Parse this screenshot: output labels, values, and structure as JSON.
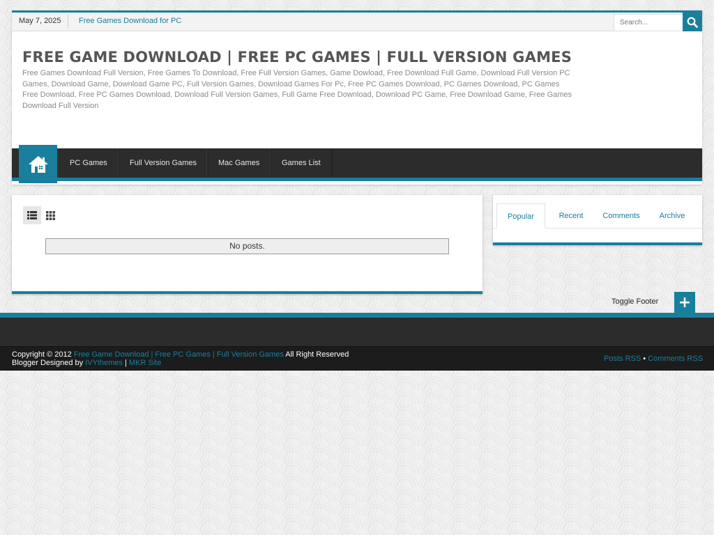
{
  "topbar": {
    "date": "May 7, 2025",
    "ticker_link": "Free Games Download for PC",
    "search_placeholder": "Search..."
  },
  "header": {
    "title": "FREE GAME DOWNLOAD | FREE PC GAMES | FULL VERSION GAMES",
    "description": "Free Games Download Full Version, Free Games To Download, Free Full Version Games, Game Dowload, Free Download Full Game, Download Full Version PC Games, Download Game, Download Game PC, Full Version Games, Download Games For Pc, Free PC Games Download, PC Games Download, PC Games Free Download, Free PC Games Download, Download Full Version Games, Full Game Free Download, Download PC Game, Free Download Game, Free Games Download Full Version"
  },
  "nav": {
    "home_icon": "home-icon",
    "items": [
      {
        "label": "PC Games"
      },
      {
        "label": "Full Version Games"
      },
      {
        "label": "Mac Games"
      },
      {
        "label": "Games List"
      }
    ]
  },
  "main": {
    "view_icons": [
      "list-view-icon",
      "grid-view-icon"
    ],
    "empty_message": "No posts."
  },
  "sidebar": {
    "tabs": [
      {
        "label": "Popular",
        "active": true
      },
      {
        "label": "Recent"
      },
      {
        "label": "Comments"
      },
      {
        "label": "Archive"
      }
    ]
  },
  "toggle_footer": {
    "label": "Toggle Footer",
    "button": "+"
  },
  "footer": {
    "copyright_prefix": "Copyright © 2012",
    "site_link": "Free Game Download | Free PC Games | Full Version Games",
    "rights": "All Right Reserved",
    "designed_by": "Blogger Designed by",
    "designer_link": "IVYthemes",
    "separator": "|",
    "mkr_link": "MKR Site",
    "posts_rss": "Posts RSS",
    "bullet": "•",
    "comments_rss": "Comments RSS"
  },
  "colors": {
    "accent": "#1a7f9c",
    "nav_bg": "#2c2c2c",
    "footer_bg": "#1c1c1c"
  }
}
